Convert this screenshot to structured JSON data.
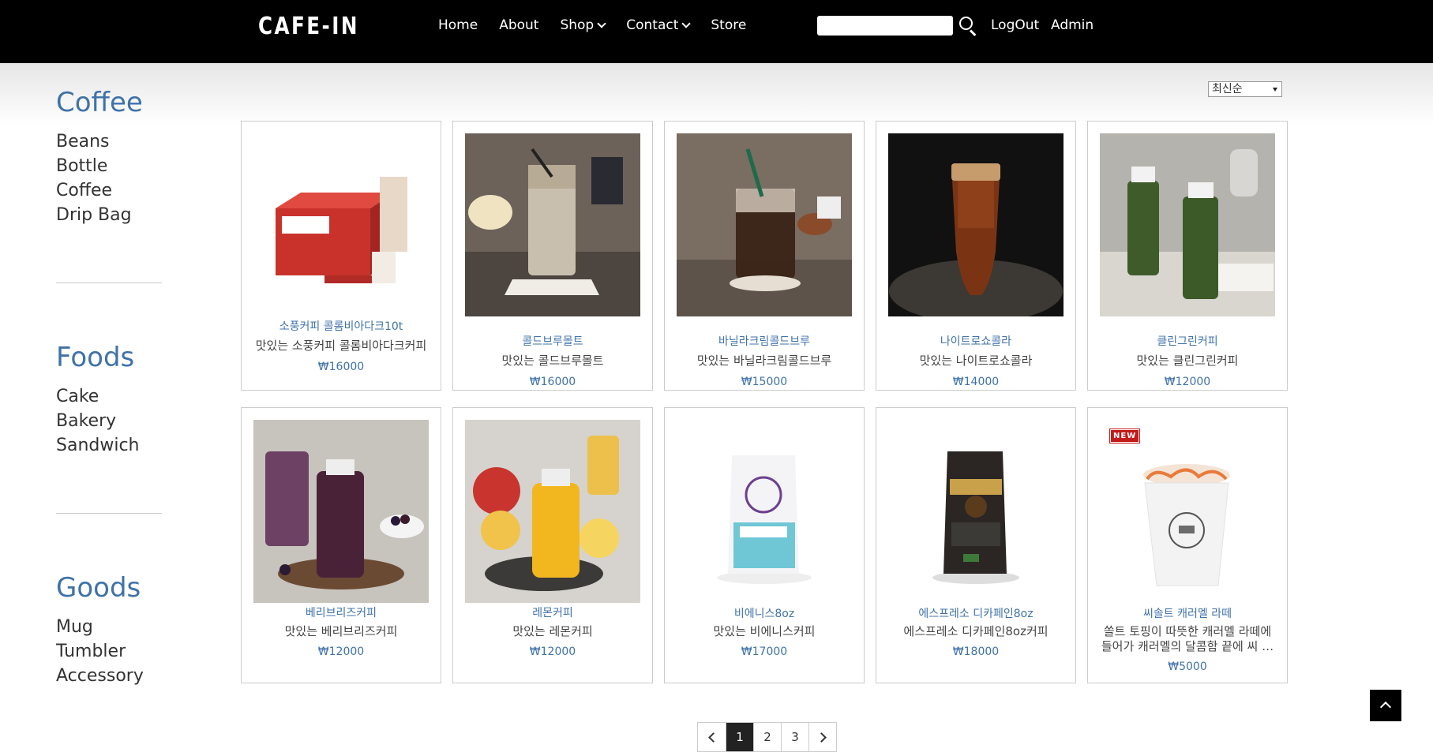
{
  "header": {
    "logo": "CAFE-IN",
    "nav": [
      {
        "label": "Home",
        "has_dropdown": false
      },
      {
        "label": "About",
        "has_dropdown": false
      },
      {
        "label": "Shop",
        "has_dropdown": true
      },
      {
        "label": "Contact",
        "has_dropdown": true
      },
      {
        "label": "Store",
        "has_dropdown": false
      }
    ],
    "search_value": "",
    "search_icon": "search-icon",
    "logout_label": "LogOut",
    "admin_label": "Admin"
  },
  "sidebar": {
    "categories": [
      {
        "title": "Coffee",
        "items": [
          "Beans",
          "Bottle Coffee",
          "Drip Bag"
        ]
      },
      {
        "title": "Foods",
        "items": [
          "Cake",
          "Bakery",
          "Sandwich"
        ]
      },
      {
        "title": "Goods",
        "items": [
          "Mug",
          "Tumbler",
          "Accessory"
        ]
      }
    ]
  },
  "sort": {
    "selected": "최신순"
  },
  "products": [
    {
      "name": "소풍커피 콜롬비아다크10t",
      "desc": "맛있는 소풍커피 콜롬비아다크커피",
      "price": "₩16000",
      "image": "sopung-coffee-box"
    },
    {
      "name": "콜드브루몰트",
      "desc": "맛있는 콜드브루몰트",
      "price": "₩16000",
      "image": "cold-brew-malt"
    },
    {
      "name": "바닐라크림콜드브루",
      "desc": "맛있는 바닐라크림콜드브루",
      "price": "₩15000",
      "image": "vanilla-cream-cold-brew"
    },
    {
      "name": "나이트로쇼콜라",
      "desc": "맛있는 나이트로쇼콜라",
      "price": "₩14000",
      "image": "nitro-chocolate"
    },
    {
      "name": "클린그린커피",
      "desc": "맛있는 클린그린커피",
      "price": "₩12000",
      "image": "clean-green-bottles"
    },
    {
      "name": "베리브리즈커피",
      "desc": "맛있는 베리브리즈커피",
      "price": "₩12000",
      "image": "berry-breeze-bottle"
    },
    {
      "name": "레몬커피",
      "desc": "맛있는 레몬커피",
      "price": "₩12000",
      "image": "lemon-bottle"
    },
    {
      "name": "비에니스8oz",
      "desc": "맛있는 비에니스커피",
      "price": "₩17000",
      "image": "viennese-bag"
    },
    {
      "name": "에스프레소 디카페인8oz",
      "desc": "에스프레소 디카페인8oz커피",
      "price": "₩18000",
      "image": "espresso-decaf-bag"
    },
    {
      "name": "씨솔트 캐러멜 라떼",
      "desc": "쏠트 토핑이 따뜻한 캐러멜 라떼에 들어가 캐러멜의 달콤함 끝에 씨 …",
      "price": "₩5000",
      "image": "sea-salt-caramel-latte",
      "badge": "NEW"
    }
  ],
  "pagination": {
    "pages": [
      "1",
      "2",
      "3"
    ],
    "current": "1"
  },
  "colors": {
    "header_bg": "#000000",
    "accent": "#3f72a8",
    "badge": "#c41a1a"
  }
}
